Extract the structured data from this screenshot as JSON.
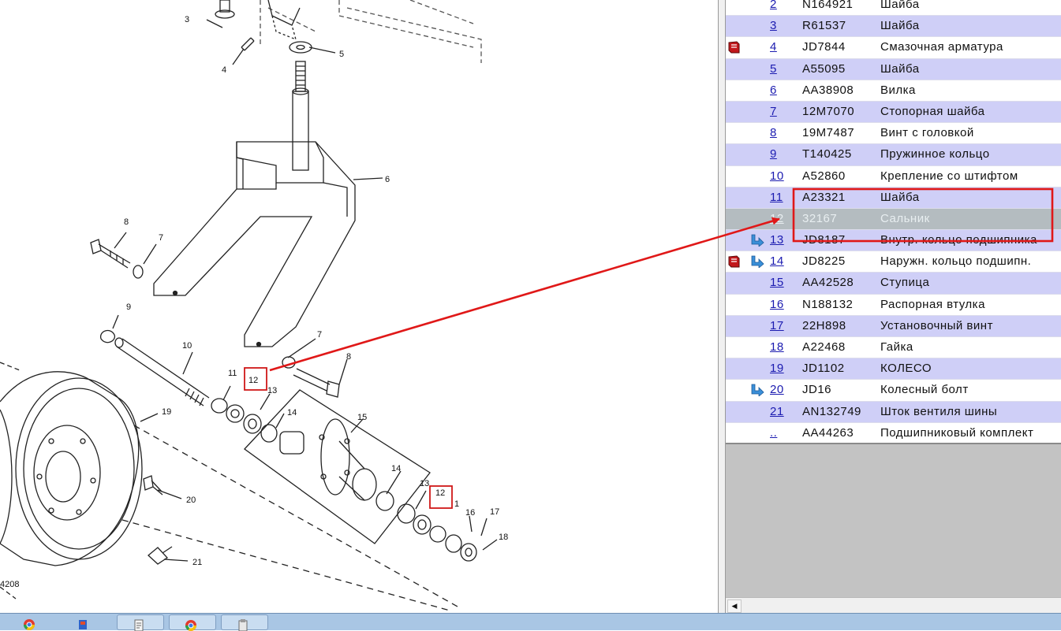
{
  "diagram": {
    "figure_id": "4208",
    "callouts": {
      "c3": "3",
      "c4": "4",
      "c5": "5",
      "c6": "6",
      "c7a": "7",
      "c7b": "7",
      "c8a": "8",
      "c8b": "8",
      "c9": "9",
      "c10": "10",
      "c11": "11",
      "c12a": "12",
      "c12b": "12",
      "c13a": "13",
      "c13b": "13",
      "c14a": "14",
      "c14b": "14",
      "c15": "15",
      "c16": "16",
      "c17": "17",
      "c18": "18",
      "c19": "19",
      "c20": "20",
      "c21": "21",
      "c1": "1"
    }
  },
  "parts": [
    {
      "num": "2",
      "part": "N164921",
      "desc": "Шайба",
      "icons": []
    },
    {
      "num": "3",
      "part": "R61537",
      "desc": "Шайба",
      "icons": []
    },
    {
      "num": "4",
      "part": "JD7844",
      "desc": "Смазочная арматура",
      "icons": [
        "book-icon"
      ]
    },
    {
      "num": "5",
      "part": "A55095",
      "desc": "Шайба",
      "icons": []
    },
    {
      "num": "6",
      "part": "AA38908",
      "desc": "Вилка",
      "icons": []
    },
    {
      "num": "7",
      "part": "12M7070",
      "desc": "Стопорная шайба",
      "icons": []
    },
    {
      "num": "8",
      "part": "19M7487",
      "desc": "Винт с головкой",
      "icons": []
    },
    {
      "num": "9",
      "part": "T140425",
      "desc": "Пружинное кольцо",
      "icons": []
    },
    {
      "num": "10",
      "part": "A52860",
      "desc": "Крепление со штифтом",
      "icons": []
    },
    {
      "num": "11",
      "part": "A23321",
      "desc": "Шайба",
      "icons": []
    },
    {
      "num": "12",
      "part": "32167",
      "desc": "Сальник",
      "icons": [],
      "selected": true
    },
    {
      "num": "13",
      "part": "JD8187",
      "desc": "Внутр. кольцо подшипника",
      "icons": [
        "arrow-icon"
      ]
    },
    {
      "num": "14",
      "part": "JD8225",
      "desc": "Наружн. кольцо подшипн.",
      "icons": [
        "book-icon",
        "arrow-icon"
      ]
    },
    {
      "num": "15",
      "part": "AA42528",
      "desc": "Ступица",
      "icons": []
    },
    {
      "num": "16",
      "part": "N188132",
      "desc": "Распорная втулка",
      "icons": []
    },
    {
      "num": "17",
      "part": "22H898",
      "desc": "Установочный винт",
      "icons": []
    },
    {
      "num": "18",
      "part": "A22468",
      "desc": "Гайка",
      "icons": []
    },
    {
      "num": "19",
      "part": "JD1102",
      "desc": "КОЛЕСО",
      "icons": []
    },
    {
      "num": "20",
      "part": "JD16",
      "desc": "Колесный болт",
      "icons": [
        "arrow-icon"
      ]
    },
    {
      "num": "21",
      "part": "AN132749",
      "desc": "Шток вентиля шины",
      "icons": []
    },
    {
      "num": "..",
      "part": "AA44263",
      "desc": "Подшипниковый комплект",
      "icons": []
    }
  ],
  "colors": {
    "row_alt": "#cfcff7",
    "row_selected": "#b4bcc0",
    "link": "#1b1bb0",
    "annotation_red": "#e01818",
    "taskbar": "#a9c6e4"
  },
  "taskbar": {
    "items": [
      "chrome-icon",
      "network-icon",
      "document-icon",
      "chrome-icon",
      "clipboard-icon"
    ]
  }
}
